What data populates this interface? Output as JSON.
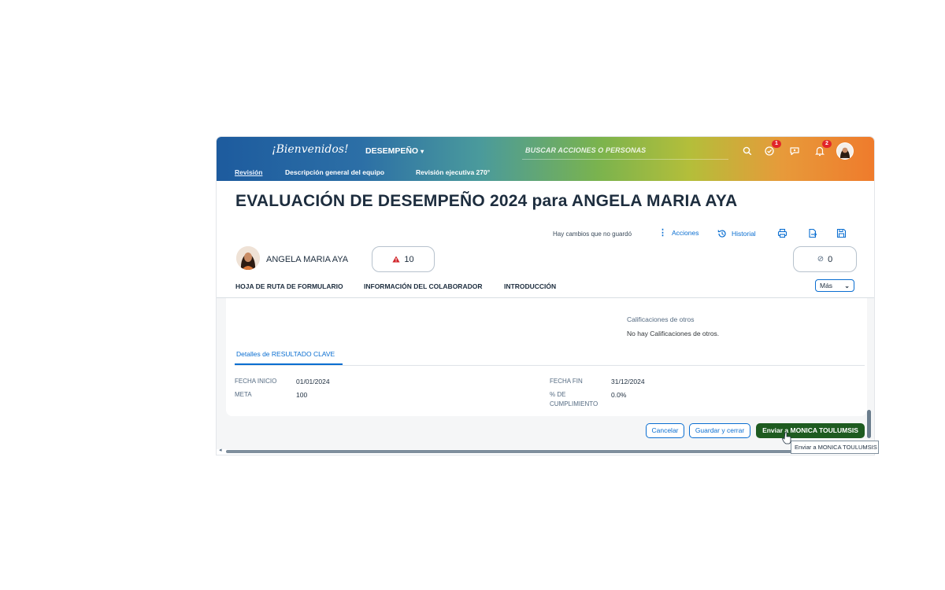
{
  "shell": {
    "logo_text": "¡Bienvenidos!",
    "module_label": "DESEMPEÑO",
    "search_placeholder": "BUSCAR ACCIONES O PERSONAS",
    "icons": [
      "search-icon",
      "todo-icon",
      "chat-icon",
      "bell-icon",
      "user-avatar"
    ],
    "todo_badge": "1",
    "notifications_badge": "2",
    "subnav": [
      "Revisión",
      "Descripción general del equipo",
      "Revisión ejecutiva 270°"
    ]
  },
  "page": {
    "title": "EVALUACIÓN DE DESEMPEÑO 2024 para ANGELA MARIA AYA",
    "unsaved_changes": "Hay cambios que no guardó",
    "actions_label": "Acciones",
    "history_label": "Historial",
    "toolbar_icons": [
      "print-icon",
      "export-icon",
      "save-icon"
    ]
  },
  "employee": {
    "name": "ANGELA MARIA AYA",
    "alerts_count": "10",
    "attachments_count": "0"
  },
  "tabs": [
    "HOJA DE RUTA DE FORMULARIO",
    "INFORMACIÓN DEL COLABORADOR",
    "INTRODUCCIÓN"
  ],
  "more_label": "Más",
  "ratings": {
    "title": "Calificaciones de otros",
    "empty_text": "No hay Calificaciones de otros."
  },
  "key_result": {
    "tab_label": "Detalles de RESULTADO CLAVE",
    "start_label": "FECHA INICIO",
    "start_value": "01/01/2024",
    "goal_label": "META",
    "goal_value": "100",
    "end_label": "FECHA FIN",
    "end_value": "31/12/2024",
    "completion_label_1": "% DE",
    "completion_label_2": "CUMPLIMIENTO",
    "completion_value": "0.0%"
  },
  "footer": {
    "cancel_label": "Cancelar",
    "save_close_label": "Guardar y cerrar",
    "send_label": "Enviar a MONICA TOULUMSIS",
    "tooltip": "Enviar a MONICA TOULUMSIS"
  },
  "colors": {
    "accent": "#0a6ed1",
    "primary_button": "#1e5b20",
    "badge": "#e2242a",
    "alert": "#d1242a"
  }
}
